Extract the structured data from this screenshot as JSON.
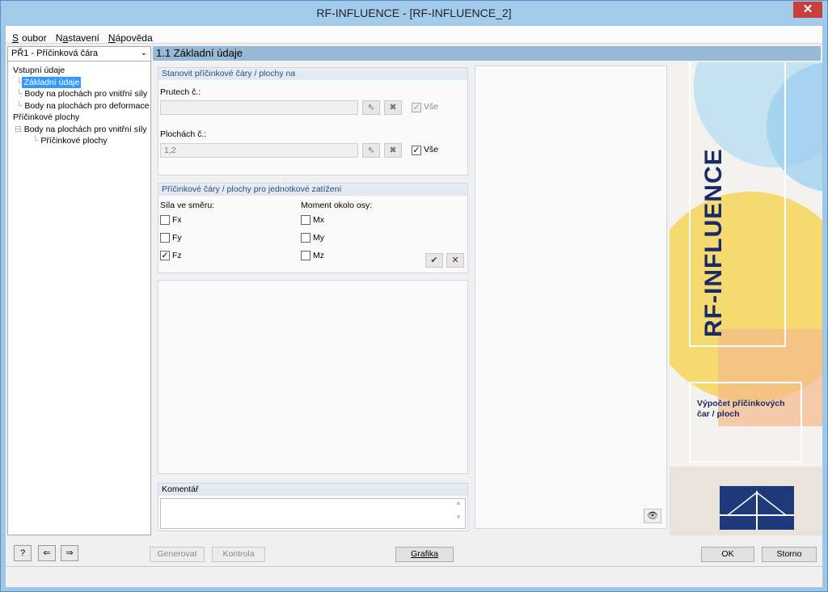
{
  "window": {
    "title": "RF-INFLUENCE - [RF-INFLUENCE_2]",
    "close_glyph": "✕"
  },
  "menu": {
    "items": [
      {
        "u": "S",
        "rest": "oubor"
      },
      {
        "pre": "N",
        "u": "a",
        "rest": "stavení"
      },
      {
        "u": "N",
        "rest": "ápověda"
      }
    ]
  },
  "nav": {
    "module_select": "PŘ1 - Příčinková čára",
    "tree": [
      {
        "label": "Vstupní údaje",
        "indent": 0,
        "selected": false
      },
      {
        "label": "Základní údaje",
        "indent": 1,
        "selected": true
      },
      {
        "label": "Body na plochách pro vnitřní síly",
        "indent": 1,
        "selected": false
      },
      {
        "label": "Body na plochách pro deformace",
        "indent": 1,
        "selected": false
      },
      {
        "label": "Příčinkové plochy",
        "indent": 0,
        "selected": false
      },
      {
        "label": "Body na plochách pro vnitřní síly",
        "indent": 1,
        "selected": false
      },
      {
        "label": "Příčinkové plochy",
        "indent": 2,
        "selected": false
      }
    ]
  },
  "page": {
    "title": "1.1 Základní údaje"
  },
  "group1": {
    "title": "Stanovit příčinkové čáry / plochy na",
    "members_label": "Prutech č.:",
    "members_value": "",
    "members_all": "Vše",
    "surfaces_label": "Plochách č.:",
    "surfaces_value": "1,2",
    "surfaces_all": "Vše"
  },
  "group2": {
    "title": "Příčinkové čáry / plochy pro jednotkové zatížení",
    "force_label": "Síla ve směru:",
    "moment_label": "Moment okolo osy:",
    "forces": [
      {
        "name": "Fx",
        "checked": false
      },
      {
        "name": "Fy",
        "checked": false
      },
      {
        "name": "Fz",
        "checked": true
      }
    ],
    "moments": [
      {
        "name": "Mx",
        "checked": false
      },
      {
        "name": "My",
        "checked": false
      },
      {
        "name": "Mz",
        "checked": false
      }
    ]
  },
  "comment": {
    "title": "Komentář",
    "value": ""
  },
  "banner": {
    "title": "RF-INFLUENCE",
    "desc_line1": "Výpočet příčinkových",
    "desc_line2": "čar / ploch"
  },
  "buttons": {
    "generate": "Generovat",
    "check": "Kontrola",
    "graphics": "Grafika",
    "ok": "OK",
    "cancel": "Storno"
  },
  "icons": [
    "help-icon",
    "import-icon",
    "export-icon",
    "select-pointer-icon",
    "delete-x-icon",
    "check-all-icon",
    "uncheck-all-icon",
    "eye-icon"
  ]
}
